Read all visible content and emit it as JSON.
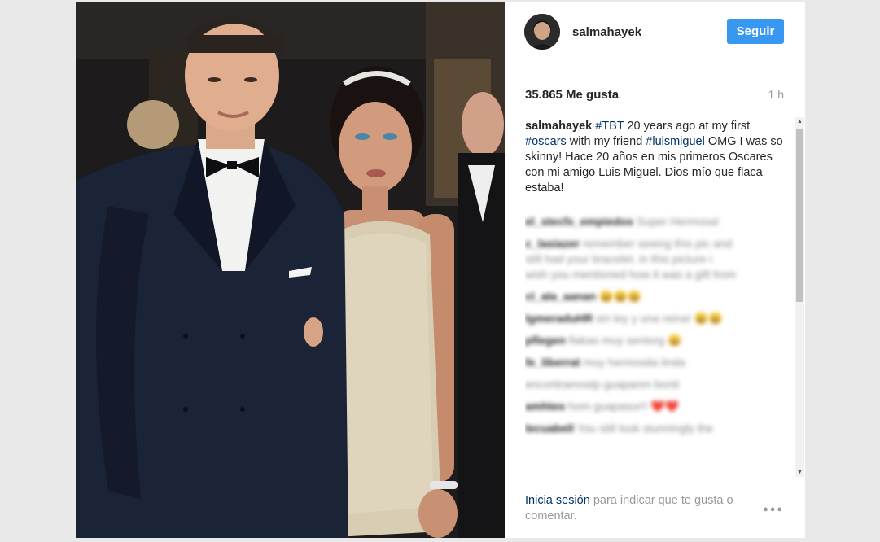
{
  "post": {
    "username": "salmahayek",
    "follow_label": "Seguir",
    "likes": "35.865 Me gusta",
    "time_ago": "1 h",
    "caption": {
      "author": "salmahayek",
      "tag1": "#TBT",
      "text1": " 20 years ago at my first ",
      "tag2": "#oscars",
      "text2": " with my friend ",
      "tag3": "#luismiguel",
      "text3": " OMG I was so skinny! Hace 20 años en mis primeros Oscares con mi amigo Luis Miguel. Dios mío que flaca estaba!"
    },
    "comments": [
      {
        "user": "el_stecfx_empiedos",
        "text": "Super Hermosa!"
      },
      {
        "user": "c_lasiazer",
        "text": "remember seeing this pic and"
      },
      {
        "user": "",
        "text": "still had your bracelet. in this picture i"
      },
      {
        "user": "",
        "text": "wish you mentioned how it was a gift from"
      },
      {
        "user": "cl_ala_aanan",
        "text": "😀😀😀"
      },
      {
        "user": "lgmeraduHR",
        "text": "sin ley y una reina! 😀😀"
      },
      {
        "user": "pflegen",
        "text": "flakas muy sentorg 😀"
      },
      {
        "user": "fe_liberrat",
        "text": "muy hermosita linda"
      },
      {
        "user": "",
        "text": "encontramostp guapanm bonit"
      },
      {
        "user": "amhtes",
        "text": "hom guapasor!! ❤️❤️"
      },
      {
        "user": "lecuabell",
        "text": "You still look stunningly the"
      }
    ],
    "footer": {
      "login_link": "Inicia sesión",
      "rest": " para indicar que te gusta o comentar."
    },
    "icons": {
      "more": "more-options-icon",
      "avatar": "avatar",
      "scroll_up": "scroll-up-arrow-icon",
      "scroll_down": "scroll-down-arrow-icon"
    },
    "colors": {
      "follow_button": "#3897f0",
      "hashtag": "#003569",
      "muted_text": "#999999"
    }
  }
}
